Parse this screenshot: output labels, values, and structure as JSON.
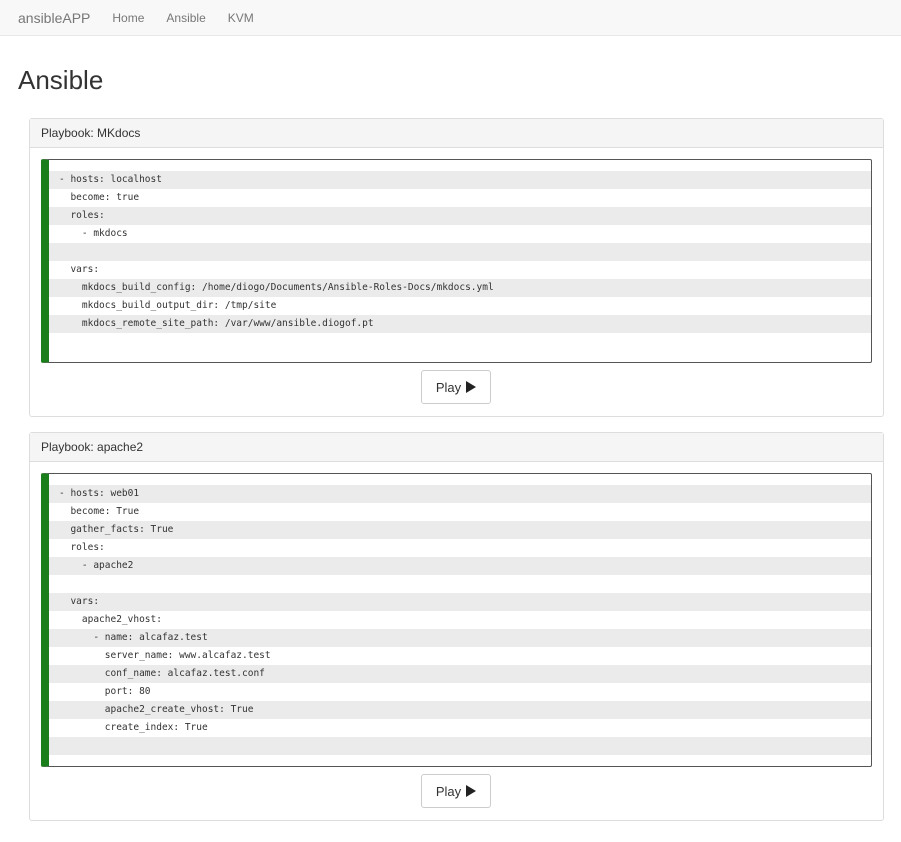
{
  "navbar": {
    "brand": "ansibleAPP",
    "links": [
      "Home",
      "Ansible",
      "KVM"
    ]
  },
  "page": {
    "title": "Ansible"
  },
  "playbooks": [
    {
      "heading": "Playbook: MKdocs",
      "lines": [
        "- hosts: localhost",
        "  become: true",
        "  roles:",
        "    - mkdocs",
        "",
        "  vars:",
        "    mkdocs_build_config: /home/diogo/Documents/Ansible-Roles-Docs/mkdocs.yml",
        "    mkdocs_build_output_dir: /tmp/site",
        "    mkdocs_remote_site_path: /var/www/ansible.diogof.pt",
        ""
      ],
      "play_label": "Play"
    },
    {
      "heading": "Playbook: apache2",
      "lines": [
        "- hosts: web01",
        "  become: True",
        "  gather_facts: True",
        "  roles:",
        "    - apache2",
        "",
        "  vars:",
        "    apache2_vhost:",
        "      - name: alcafaz.test",
        "        server_name: www.alcafaz.test",
        "        conf_name: alcafaz.test.conf",
        "        port: 80",
        "        apache2_create_vhost: True",
        "        create_index: True",
        ""
      ],
      "play_label": "Play"
    }
  ],
  "colors": {
    "code_accent": "#1a7f1a",
    "stripe": "#ebebeb"
  }
}
